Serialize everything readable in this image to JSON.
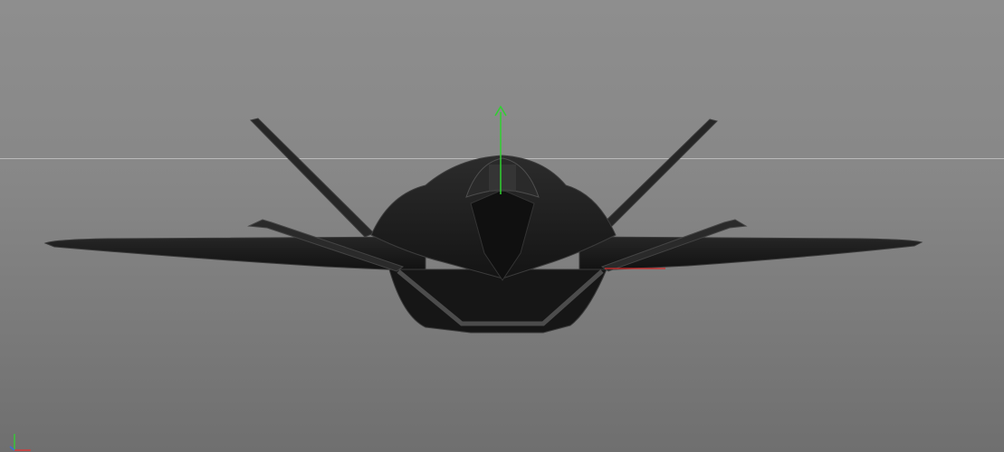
{
  "viewport": {
    "background_top": "#8e8e8e",
    "background_bottom": "#6f6f6f",
    "horizon_color": "#b9b9b9"
  },
  "model": {
    "body_color": "#1c1c1c",
    "edge_color": "#3a3a3a",
    "highlight_color": "#4a4a4a"
  },
  "manipulator": {
    "y_axis_color": "#2fd12f",
    "x_axis_color": "#d22b2b"
  },
  "axis_gizmo": {
    "y_color": "#39c539",
    "x_color": "#d63a3a",
    "z_color": "#3a6fd6"
  }
}
